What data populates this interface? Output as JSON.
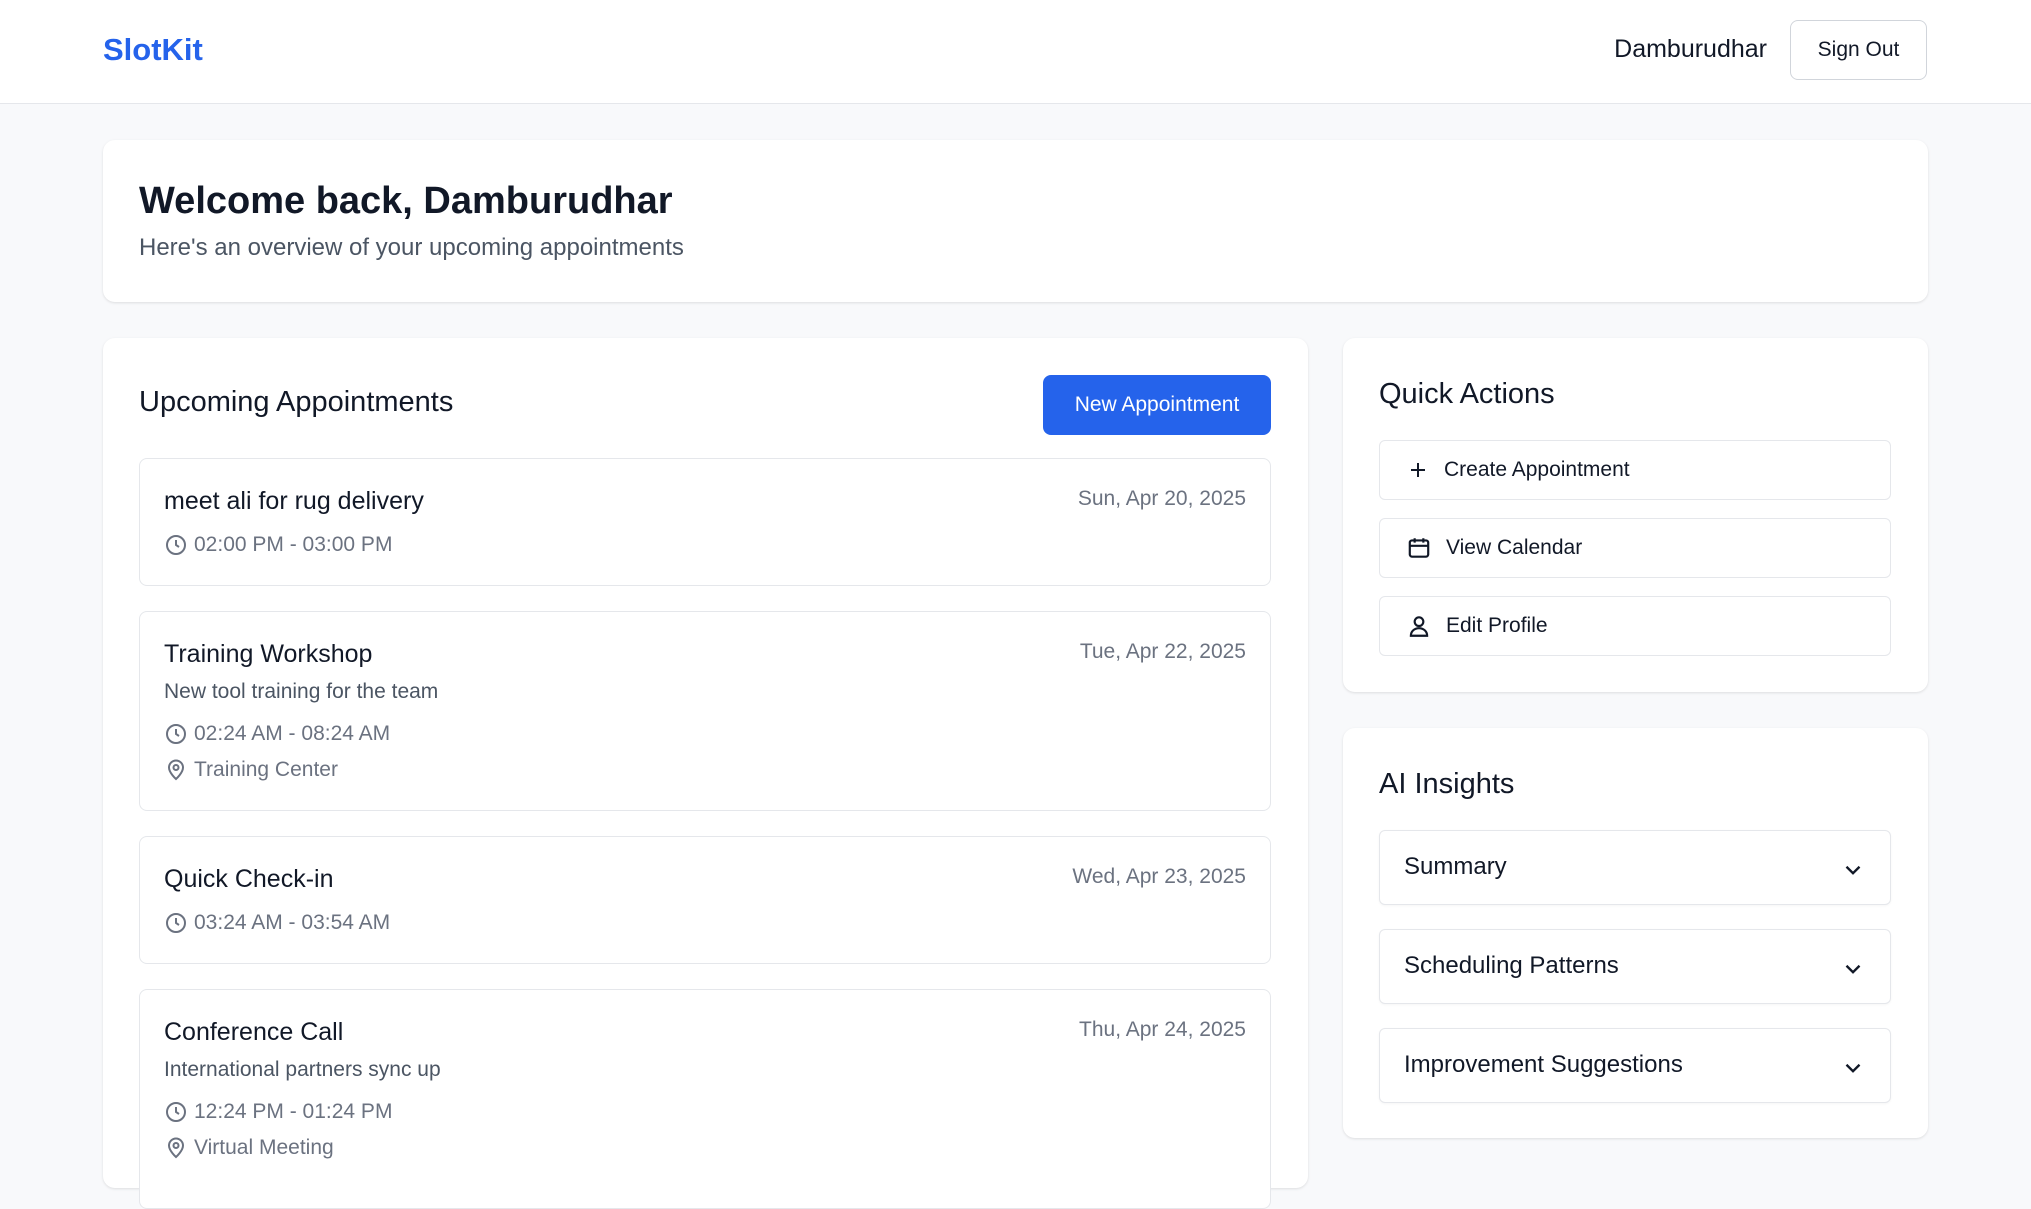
{
  "header": {
    "logo": "SlotKit",
    "user_name": "Damburudhar",
    "sign_out_label": "Sign Out"
  },
  "welcome": {
    "title": "Welcome back, Damburudhar",
    "subtitle": "Here's an overview of your upcoming appointments"
  },
  "appointments": {
    "title": "Upcoming Appointments",
    "new_label": "New Appointment",
    "items": [
      {
        "title": "meet ali for rug delivery",
        "date": "Sun, Apr 20, 2025",
        "time": "02:00 PM - 03:00 PM"
      },
      {
        "title": "Training Workshop",
        "date": "Tue, Apr 22, 2025",
        "description": "New tool training for the team",
        "time": "02:24 AM - 08:24 AM",
        "location": "Training Center"
      },
      {
        "title": "Quick Check-in",
        "date": "Wed, Apr 23, 2025",
        "time": "03:24 AM - 03:54 AM"
      },
      {
        "title": "Conference Call",
        "date": "Thu, Apr 24, 2025",
        "description": "International partners sync up",
        "time": "12:24 PM - 01:24 PM",
        "location": "Virtual Meeting"
      }
    ]
  },
  "quick_actions": {
    "title": "Quick Actions",
    "items": [
      {
        "label": "Create Appointment",
        "icon": "plus-icon"
      },
      {
        "label": "View Calendar",
        "icon": "calendar-icon"
      },
      {
        "label": "Edit Profile",
        "icon": "user-icon"
      }
    ]
  },
  "ai_insights": {
    "title": "AI Insights",
    "sections": [
      {
        "label": "Summary"
      },
      {
        "label": "Scheduling Patterns"
      },
      {
        "label": "Improvement Suggestions"
      }
    ]
  },
  "colors": {
    "accent": "#2563eb",
    "background": "#f8f9fb",
    "border": "#e5e7eb",
    "muted_text": "#6b7280"
  }
}
